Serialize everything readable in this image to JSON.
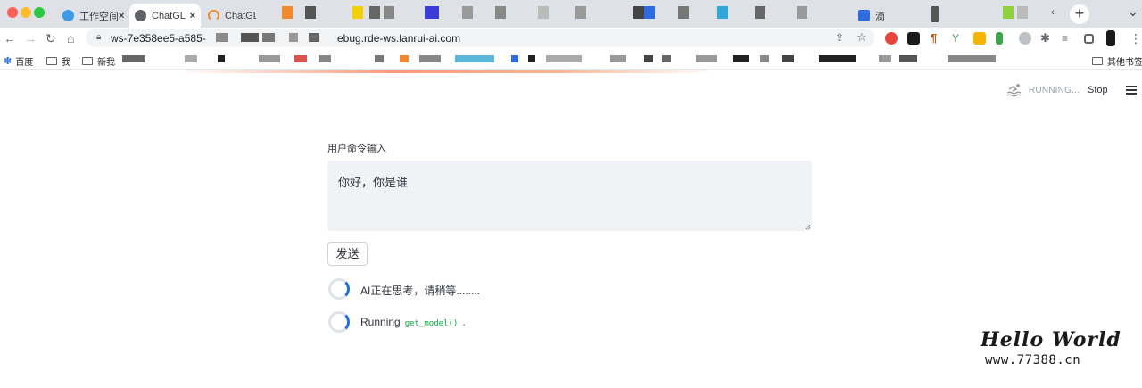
{
  "browser": {
    "tabs": [
      {
        "title": "工作空间",
        "close": "×",
        "favicon_color": "#3c9be8"
      },
      {
        "title": "ChatGL",
        "close": "×",
        "favicon_color": "#5f6368"
      },
      {
        "title": "ChatGL",
        "favicon_color": "#f08a2c"
      },
      {
        "title": "滴",
        "favicon_color": "#2d6be0"
      }
    ],
    "new_tab": "+",
    "tab_menu": "⌄",
    "tab_scroll_left": "‹",
    "back": "←",
    "forward": "→",
    "reload": "↻",
    "home": "⌂",
    "url_prefix": "ws-7e358ee5-a585-",
    "url_suffix": "ebug.rde-ws.lanrui-ai.com",
    "share_icon": "⇪",
    "star_icon": "☆",
    "extension_colors": [
      "#e8453c",
      "#1a1a1a",
      "#b8580e",
      "#3fa34d",
      "#f4b400",
      "#3fa34d",
      "#5f6368",
      "#5f6368",
      "#5f6368",
      "#1a1a1a"
    ],
    "bookmarks": {
      "items": [
        "百度",
        "我",
        "新我"
      ],
      "other": "其他书签"
    }
  },
  "app": {
    "status": "RUNNING...",
    "stop_label": "Stop",
    "input_label": "用户命令输入",
    "input_value": "你好，你是谁",
    "send_label": "发送",
    "spinner_color": "#1f6fe0",
    "status_thinking": "AI正在思考，请稍等........",
    "status_running_prefix": "Running",
    "status_running_code": "get_model()",
    "status_running_suffix": ".",
    "code_color": "#09ab3b"
  },
  "watermark": {
    "title": "Hello World",
    "url": "www.77388.cn"
  }
}
